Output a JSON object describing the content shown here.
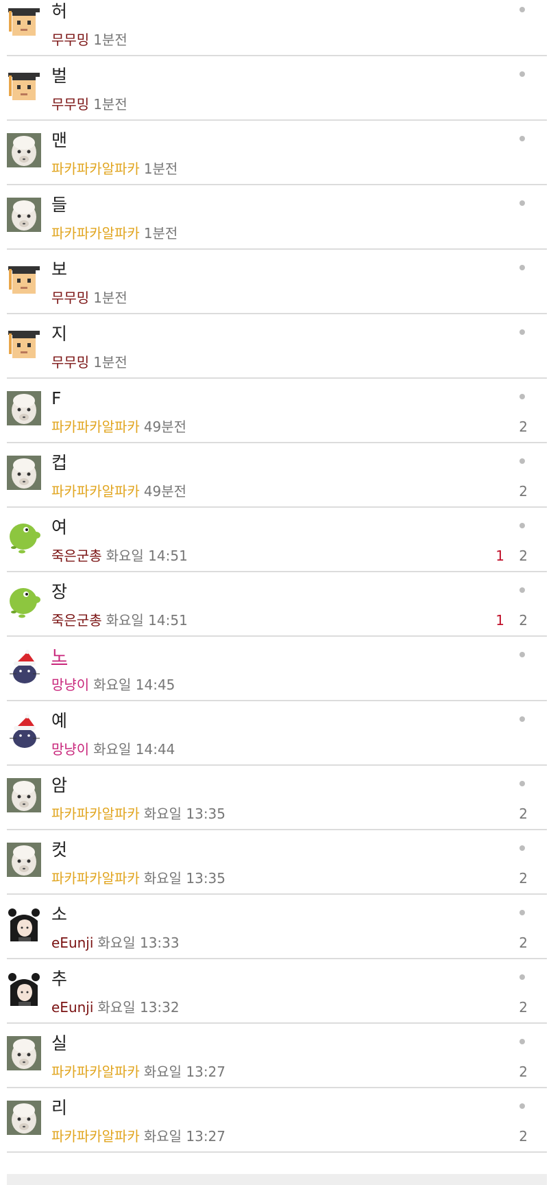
{
  "colors": {
    "author_dark_red": "#7a1212",
    "author_gold": "#e1a51f",
    "author_pink": "#c8267b",
    "title_pink": "#c8267b",
    "new_count_red": "#c0102a",
    "meta_gray": "#777777",
    "divider": "#dcdcdc"
  },
  "posts": [
    {
      "title": "허",
      "author": "무무밍",
      "time": "1분전",
      "count": "",
      "new_count": "",
      "avatar": "graduation-cap-avatar-icon",
      "author_color": "#7a1212",
      "title_color": "#222222"
    },
    {
      "title": "벌",
      "author": "무무밍",
      "time": "1분전",
      "count": "",
      "new_count": "",
      "avatar": "graduation-cap-avatar-icon",
      "author_color": "#7a1212",
      "title_color": "#222222"
    },
    {
      "title": "맨",
      "author": "파카파카알파카",
      "time": "1분전",
      "count": "",
      "new_count": "",
      "avatar": "alpaca-avatar-icon",
      "author_color": "#e1a51f",
      "title_color": "#222222"
    },
    {
      "title": "들",
      "author": "파카파카알파카",
      "time": "1분전",
      "count": "",
      "new_count": "",
      "avatar": "alpaca-avatar-icon",
      "author_color": "#e1a51f",
      "title_color": "#222222"
    },
    {
      "title": "보",
      "author": "무무밍",
      "time": "1분전",
      "count": "",
      "new_count": "",
      "avatar": "graduation-cap-avatar-icon",
      "author_color": "#7a1212",
      "title_color": "#222222"
    },
    {
      "title": "지",
      "author": "무무밍",
      "time": "1분전",
      "count": "",
      "new_count": "",
      "avatar": "graduation-cap-avatar-icon",
      "author_color": "#7a1212",
      "title_color": "#222222"
    },
    {
      "title": "F",
      "author": "파카파카알파카",
      "time": "49분전",
      "count": "2",
      "new_count": "",
      "avatar": "alpaca-avatar-icon",
      "author_color": "#e1a51f",
      "title_color": "#222222"
    },
    {
      "title": "컵",
      "author": "파카파카알파카",
      "time": "49분전",
      "count": "2",
      "new_count": "",
      "avatar": "alpaca-avatar-icon",
      "author_color": "#e1a51f",
      "title_color": "#222222"
    },
    {
      "title": "여",
      "author": "죽은군총",
      "time": "화요일 14:51",
      "count": "2",
      "new_count": "1",
      "avatar": "green-bird-avatar-icon",
      "author_color": "#7a1212",
      "title_color": "#222222"
    },
    {
      "title": "장",
      "author": "죽은군총",
      "time": "화요일 14:51",
      "count": "2",
      "new_count": "1",
      "avatar": "green-bird-avatar-icon",
      "author_color": "#7a1212",
      "title_color": "#222222"
    },
    {
      "title": "노",
      "author": "망냥이",
      "time": "화요일 14:45",
      "count": "",
      "new_count": "",
      "avatar": "santa-cat-avatar-icon",
      "author_color": "#c8267b",
      "title_color": "#c8267b",
      "title_underline": true
    },
    {
      "title": "예",
      "author": "망냥이",
      "time": "화요일 14:44",
      "count": "",
      "new_count": "",
      "avatar": "santa-cat-avatar-icon",
      "author_color": "#c8267b",
      "title_color": "#222222"
    },
    {
      "title": "암",
      "author": "파카파카알파카",
      "time": "화요일 13:35",
      "count": "2",
      "new_count": "",
      "avatar": "alpaca-avatar-icon",
      "author_color": "#e1a51f",
      "title_color": "#222222"
    },
    {
      "title": "컷",
      "author": "파카파카알파카",
      "time": "화요일 13:35",
      "count": "2",
      "new_count": "",
      "avatar": "alpaca-avatar-icon",
      "author_color": "#e1a51f",
      "title_color": "#222222"
    },
    {
      "title": "소",
      "author": "eEunji",
      "time": "화요일 13:33",
      "count": "2",
      "new_count": "",
      "avatar": "dark-hair-girl-avatar-icon",
      "author_color": "#7a1212",
      "title_color": "#222222"
    },
    {
      "title": "추",
      "author": "eEunji",
      "time": "화요일 13:32",
      "count": "2",
      "new_count": "",
      "avatar": "dark-hair-girl-avatar-icon",
      "author_color": "#7a1212",
      "title_color": "#222222"
    },
    {
      "title": "실",
      "author": "파카파카알파카",
      "time": "화요일 13:27",
      "count": "2",
      "new_count": "",
      "avatar": "alpaca-avatar-icon",
      "author_color": "#e1a51f",
      "title_color": "#222222"
    },
    {
      "title": "리",
      "author": "파카파카알파카",
      "time": "화요일 13:27",
      "count": "2",
      "new_count": "",
      "avatar": "alpaca-avatar-icon",
      "author_color": "#e1a51f",
      "title_color": "#222222"
    }
  ]
}
